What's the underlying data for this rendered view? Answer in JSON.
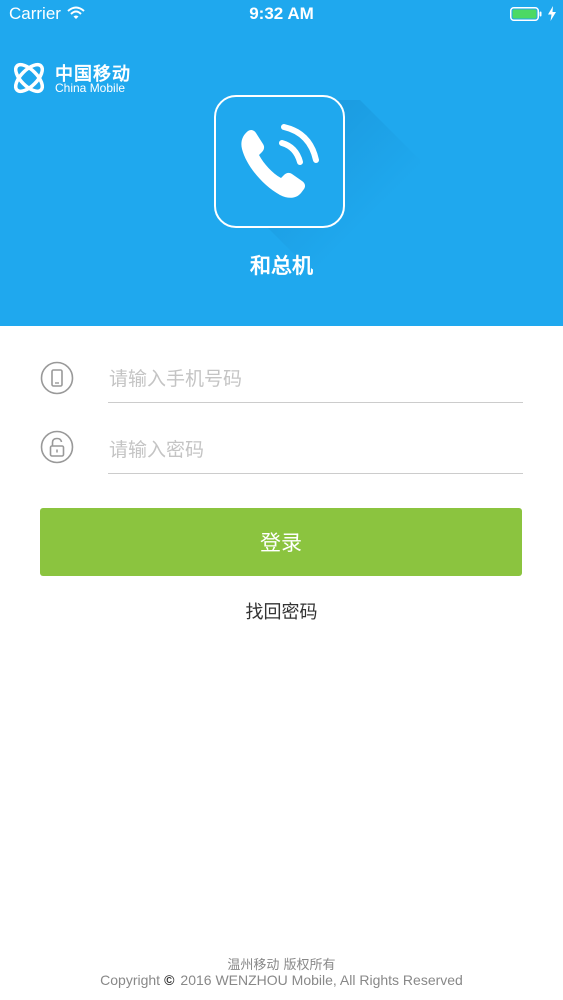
{
  "status_bar": {
    "carrier": "Carrier",
    "time": "9:32 AM",
    "icons": [
      "wifi-icon",
      "battery-icon",
      "charging-icon"
    ],
    "battery_color": "#4cd964"
  },
  "brand": {
    "logo_icon": "china-mobile-logo-icon",
    "name_cn": "中国移动",
    "name_en": "China Mobile"
  },
  "app": {
    "icon": "phone-call-icon",
    "name": "和总机"
  },
  "login_form": {
    "phone": {
      "icon": "mobile-phone-icon",
      "value": "",
      "placeholder": "请输入手机号码"
    },
    "password": {
      "icon": "padlock-icon",
      "value": "",
      "placeholder": "请输入密码"
    },
    "submit_label": "登录",
    "forgot_password_label": "找回密码"
  },
  "footer": {
    "rights_cn": "温州移动 版权所有",
    "copyright_prefix": "Copyright",
    "copyright_symbol": "©",
    "copyright_text": "2016 WENZHOU Mobile, All Rights Reserved"
  },
  "colors": {
    "header_bg": "#1fa8ee",
    "primary_button": "#8bc43f",
    "divider": "#cccccc",
    "placeholder": "#c4c4c4"
  }
}
